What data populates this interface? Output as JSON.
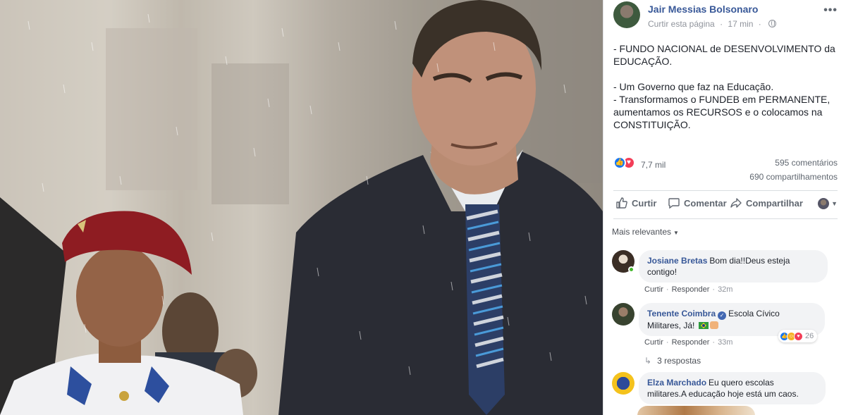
{
  "post": {
    "author": "Jair Messias Bolsonaro",
    "like_page": "Curtir esta página",
    "separator": "·",
    "time": "17 min",
    "more_icon": "more-horizontal-icon",
    "privacy_icon": "globe-icon",
    "text_lines": [
      "- FUNDO NACIONAL de DESENVOLVIMENTO da",
      "EDUCAÇÃO.",
      "",
      "- Um Governo que faz na Educação.",
      "- Transformamos o FUNDEB em PERMANENTE,",
      "aumentamos os RECURSOS e o colocamos na",
      "CONSTITUIÇÃO."
    ]
  },
  "stats": {
    "reactions": "7,7 mil",
    "comments": "595 comentários",
    "shares": "690 compartilhamentos"
  },
  "actions": {
    "like": "Curtir",
    "comment": "Comentar",
    "share": "Compartilhar"
  },
  "sort": {
    "label": "Mais relevantes"
  },
  "comments": [
    {
      "name": "Josiane Bretas",
      "text_1": "Bom dia!!Deus esteja",
      "text_2": "contigo!",
      "like": "Curtir",
      "reply": "Responder",
      "time": "32m"
    },
    {
      "name": "Tenente Coimbra",
      "text_1": "Escola Cívico",
      "text_2": "Militares, Já!",
      "like": "Curtir",
      "reply": "Responder",
      "time": "33m",
      "reaction_count": "26",
      "replies": "3 respostas"
    },
    {
      "name": "Elza Marchado",
      "text_1": "Eu quero escolas",
      "text_2": "militares.A educação hoje está um caos."
    }
  ],
  "colors": {
    "link_blue": "#385898",
    "like_blue": "#1877f2",
    "love_red": "#f33e58",
    "muted": "#90949c",
    "bubble": "#f2f3f5"
  }
}
